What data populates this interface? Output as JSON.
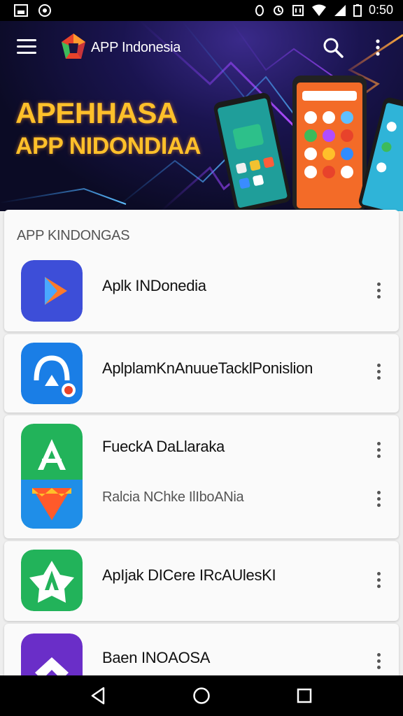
{
  "status_bar": {
    "time": "0:50"
  },
  "header": {
    "app_title": "APP Indonesia"
  },
  "hero": {
    "headline_line1": "APEHHASA",
    "headline_line2": "APP NIDONDIAA"
  },
  "section": {
    "title": "APP KINDONGAS"
  },
  "apps": [
    {
      "name": "Aplk INDonedia"
    },
    {
      "name": "AplplamKnAnuueTacklPonislion"
    },
    {
      "name": "FueckA DaLlaraka",
      "sub_name": "Ralcia NChke IlIboANia"
    },
    {
      "name": "ApIjak DICere IRcAUlesKI"
    },
    {
      "name": "Baen INOAOSA"
    }
  ],
  "colors": {
    "accent_yellow": "#ffc02a",
    "hero_bg": "#14113f",
    "app1_icon": "#3d4ed8",
    "app2_icon": "#1a7ee6",
    "app3_icon": "#22b35a",
    "app4_icon": "#22b35a",
    "app5_icon": "#6a2ec8"
  },
  "icons": [
    "menu-icon",
    "logo-icon",
    "search-icon",
    "more-vert-icon",
    "back-icon",
    "home-icon",
    "recents-icon"
  ]
}
